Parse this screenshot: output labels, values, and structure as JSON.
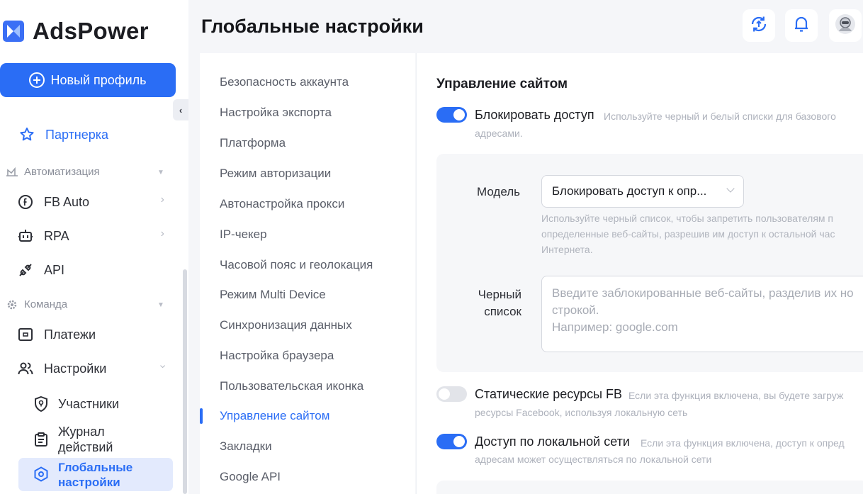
{
  "app": {
    "name": "AdsPower"
  },
  "sidebar": {
    "new_profile": "Новый профиль",
    "partner": "Партнерка",
    "automation_section": "Автоматизация",
    "fb_auto": "FB Auto",
    "rpa": "RPA",
    "api": "API",
    "team_section": "Команда",
    "payments": "Платежи",
    "settings": "Настройки",
    "members": "Участники",
    "activity_log_1": "Журнал",
    "activity_log_2": "действий",
    "global_settings_1": "Глобальные",
    "global_settings_2": "настройки"
  },
  "header": {
    "title": "Глобальные настройки"
  },
  "menu": {
    "items": [
      "Безопасность аккаунта",
      "Настройка экспорта",
      "Платформа",
      "Режим авторизации",
      "Автонастройка прокси",
      "IP-чекер",
      "Часовой пояс и геолокация",
      "Режим Multi Device",
      "Синхронизация данных",
      "Настройка браузера",
      "Пользовательская иконка",
      "Управление сайтом",
      "Закладки",
      "Google API"
    ],
    "active_index": 11
  },
  "content": {
    "section_title": "Управление сайтом",
    "block_access": {
      "label": "Блокировать доступ",
      "desc": "Используйте черный и белый списки для базового",
      "desc2": "адресами.",
      "enabled": true
    },
    "model_label": "Модель",
    "model_value": "Блокировать доступ к опр...",
    "model_help": [
      "Используйте черный список, чтобы запретить пользователям п",
      "определенные веб-сайты, разрешив им доступ к остальной час",
      "Интернета."
    ],
    "blacklist_label_1": "Черный",
    "blacklist_label_2": "список",
    "blacklist_placeholder": [
      "Введите заблокированные веб-сайты, разделив их но",
      "строкой.",
      "Например: google.com"
    ],
    "static_fb": {
      "label": "Статические ресурсы FB",
      "desc": "Если эта функция включена, вы будете загруж",
      "desc2": "ресурсы Facebook, используя локальную сеть",
      "enabled": false
    },
    "lan_access": {
      "label": "Доступ по локальной сети",
      "desc": "Если эта функция включена, доступ к опред",
      "desc2": "адресам может осуществляться по локальной сети",
      "enabled": true
    }
  },
  "colors": {
    "accent": "#2a6df5",
    "active_bg": "#e3eafd"
  },
  "icons": [
    "sync-icon",
    "bell-icon",
    "avatar"
  ]
}
